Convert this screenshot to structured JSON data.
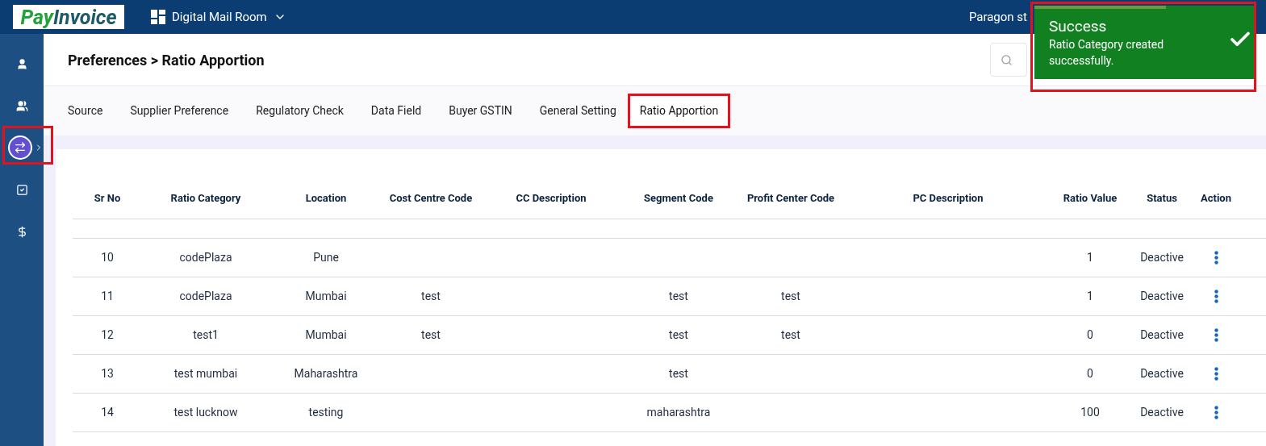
{
  "topbar": {
    "logo": {
      "pay": "Pay",
      "invoice": "Invoice"
    },
    "module": "Digital Mail Room",
    "user": "Paragon st"
  },
  "sidebar": {
    "items": [
      {
        "kind": "user",
        "selected": false
      },
      {
        "kind": "users",
        "selected": false
      },
      {
        "kind": "transfer",
        "selected": true
      },
      {
        "kind": "checklist",
        "selected": false
      },
      {
        "kind": "dollar",
        "selected": false
      }
    ]
  },
  "header": {
    "breadcrumb": "Preferences > Ratio Apportion"
  },
  "tabs": [
    {
      "label": "Source",
      "selected": false
    },
    {
      "label": "Supplier Preference",
      "selected": false
    },
    {
      "label": "Regulatory Check",
      "selected": false
    },
    {
      "label": "Data Field",
      "selected": false
    },
    {
      "label": "Buyer GSTIN",
      "selected": false
    },
    {
      "label": "General Setting",
      "selected": false
    },
    {
      "label": "Ratio Apportion",
      "selected": true
    }
  ],
  "table": {
    "columns": [
      "Sr No",
      "Ratio Category",
      "Location",
      "Cost Centre Code",
      "CC Description",
      "Segment Code",
      "Profit Center Code",
      "PC Description",
      "Ratio Value",
      "Status",
      "Action"
    ],
    "rows": [
      {
        "cells": [
          "10",
          "codePlaza",
          "Pune",
          "",
          "",
          "",
          "",
          "",
          "1",
          "Deactive"
        ]
      },
      {
        "cells": [
          "11",
          "codePlaza",
          "Mumbai",
          "test",
          "",
          "test",
          "test",
          "",
          "1",
          "Deactive"
        ]
      },
      {
        "cells": [
          "12",
          "test1",
          "Mumbai",
          "test",
          "",
          "test",
          "test",
          "",
          "0",
          "Deactive"
        ]
      },
      {
        "cells": [
          "13",
          "test mumbai",
          "Maharashtra",
          "",
          "",
          "test",
          "",
          "",
          "0",
          "Deactive"
        ]
      },
      {
        "cells": [
          "14",
          "test lucknow",
          "testing",
          "",
          "",
          "maharashtra",
          "",
          "",
          "100",
          "Deactive"
        ]
      }
    ]
  },
  "toast": {
    "title": "Success",
    "message": "Ratio Category created successfully.",
    "level": 0.6
  }
}
